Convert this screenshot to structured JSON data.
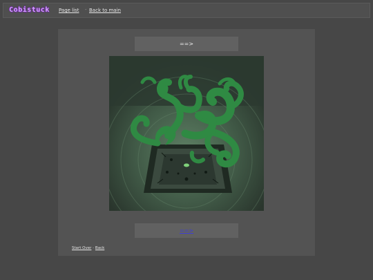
{
  "header": {
    "logo_text": "Cobistuck",
    "nav": {
      "page_list": "Page list",
      "separator": "-",
      "back_to_main": "Back to main"
    }
  },
  "panel": {
    "top_command": "==>",
    "bottom_command": "==>",
    "footer": {
      "start_over": "Start Over",
      "separator": "-",
      "back": "Back"
    }
  },
  "colors": {
    "page_background": "#474747",
    "panel_background": "#535353",
    "command_box": "#616161",
    "logo_text": "#d7a6ff",
    "vine_green": "#2f8a43",
    "link_blue": "#3d3dd8"
  },
  "image": {
    "subject": "green tendrils rising above an ornate platform in a dark green room"
  }
}
